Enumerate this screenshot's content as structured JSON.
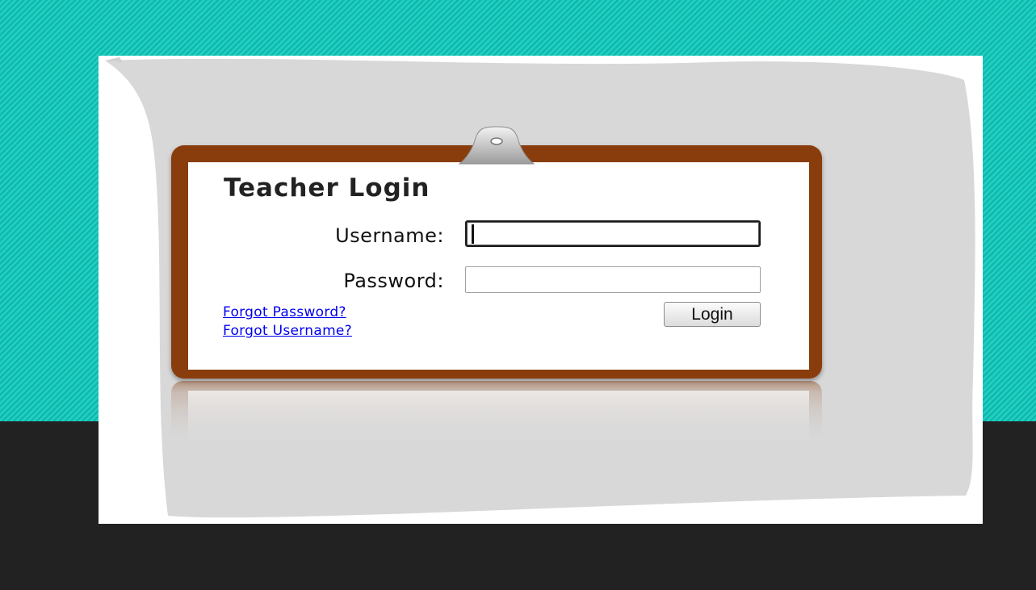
{
  "login": {
    "title": "Teacher Login",
    "username_label": "Username:",
    "password_label": "Password:",
    "username_value": "",
    "password_value": "",
    "forgot_password": "Forgot Password?",
    "forgot_username": "Forgot Username?",
    "login_button": "Login"
  },
  "colors": {
    "background_teal": "#14bdb1",
    "background_dark": "#222222",
    "paper_gray": "#d8d8d8",
    "clipboard_brown": "#8a3d0c",
    "link_blue": "#0000ee"
  },
  "icons": {
    "clip": "clipboard-clip-icon"
  }
}
